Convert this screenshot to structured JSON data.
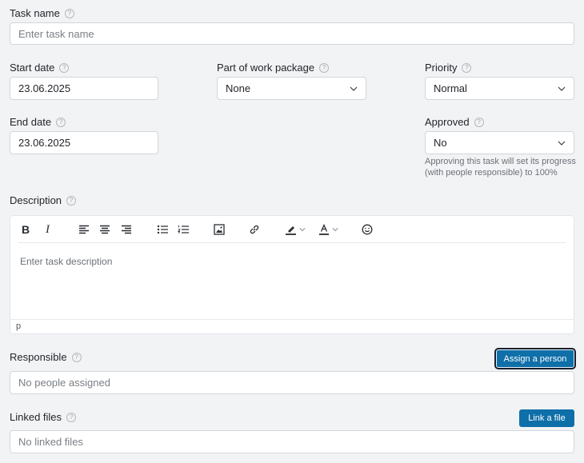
{
  "task_name": {
    "label": "Task name",
    "placeholder": "Enter task name"
  },
  "start_date": {
    "label": "Start date",
    "value": "23.06.2025"
  },
  "work_package": {
    "label": "Part of work package",
    "value": "None"
  },
  "priority": {
    "label": "Priority",
    "value": "Normal"
  },
  "end_date": {
    "label": "End date",
    "value": "23.06.2025"
  },
  "approved": {
    "label": "Approved",
    "value": "No",
    "note_line1": "Approving this task will set its progress",
    "note_line2": "(with people responsible) to 100%"
  },
  "description": {
    "label": "Description",
    "placeholder": "Enter task description",
    "status_path": "p",
    "toolbar": {
      "bold": "B",
      "italic": "I"
    }
  },
  "responsible": {
    "label": "Responsible",
    "button": "Assign a person",
    "value": "No people assigned"
  },
  "linked_files": {
    "label": "Linked files",
    "button": "Link a file",
    "value": "No linked files"
  },
  "help_glyph": "?",
  "colors": {
    "accent": "#0f6fa8",
    "background": "#f2f3f5"
  }
}
